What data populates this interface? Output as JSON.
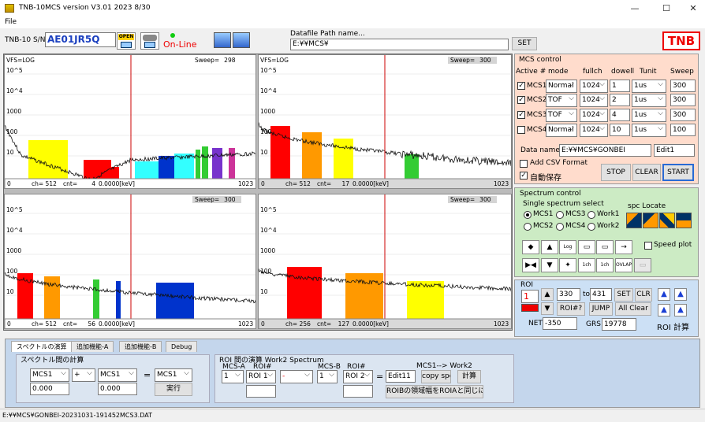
{
  "window": {
    "title": "TNB-10MCS  version V3.01  2023 8/30",
    "minimize": "—",
    "maximize": "☐",
    "close": "✕"
  },
  "menu": {
    "file": "File"
  },
  "header": {
    "sn_label": "TNB-10 S/N",
    "sn_value": "AE01JR5Q",
    "open_label": "OPEN",
    "online_label": "On-Line",
    "datafile_label": "Datafile Path name...",
    "datafile_value": "E:¥¥MCS¥",
    "set_label": "SET",
    "logo": "TNB"
  },
  "plots": [
    {
      "vfs": "VFS=LOG",
      "sweep_label": "Sweep=",
      "sweep": "298",
      "ch": "ch= 512",
      "cnt": "cnt=",
      "cnt_val": "4",
      "kev": "0.0000[keV]",
      "left": "0",
      "right": "1023",
      "y": [
        "10^5",
        "10^4",
        "1000",
        "100",
        "10"
      ]
    },
    {
      "vfs": "VFS=LOG",
      "sweep_label": "Sweep=",
      "sweep": "300",
      "ch": "ch= 512",
      "cnt": "cnt=",
      "cnt_val": "17",
      "kev": "0.0000[keV]",
      "left": "0",
      "right": "1023",
      "y": [
        "10^5",
        "10^4",
        "1000",
        "100",
        "10"
      ]
    },
    {
      "vfs": "",
      "sweep_label": "Sweep=",
      "sweep": "300",
      "ch": "ch= 512",
      "cnt": "cnt=",
      "cnt_val": "56",
      "kev": "0.0000[keV]",
      "left": "0",
      "right": "1023",
      "y": [
        "10^5",
        "10^4",
        "1000",
        "100",
        "10"
      ]
    },
    {
      "vfs": "",
      "sweep_label": "Sweep=",
      "sweep": "300",
      "ch": "ch= 256",
      "cnt": "cnt=",
      "cnt_val": "127",
      "kev": "0.0000[keV]",
      "left": "0",
      "right": "1023",
      "y": [
        "10^5",
        "10^4",
        "1000",
        "100",
        "10"
      ]
    }
  ],
  "mcs_control": {
    "title": "MCS control",
    "headers": [
      "Active #",
      "mode",
      "fullch",
      "dowell",
      "Tunit",
      "Sweep"
    ],
    "rows": [
      {
        "name": "MCS1",
        "checked": "✓",
        "mode": "Normal",
        "fullch": "1024",
        "dowell": "1",
        "tunit": "1us",
        "sweep": "300"
      },
      {
        "name": "MCS2",
        "checked": "✓",
        "mode": "TOF",
        "fullch": "1024",
        "dowell": "2",
        "tunit": "1us",
        "sweep": "300"
      },
      {
        "name": "MCS3",
        "checked": "✓",
        "mode": "TOF",
        "fullch": "1024",
        "dowell": "4",
        "tunit": "1us",
        "sweep": "300"
      },
      {
        "name": "MCS4",
        "checked": "",
        "mode": "Normal",
        "fullch": "1024",
        "dowell": "10",
        "tunit": "1us",
        "sweep": "100"
      }
    ],
    "dataname_label": "Data name",
    "dataname_value": "E:¥¥MCS¥GONBEI",
    "edit_value": "Edit1",
    "csv_label": "Add CSV Format",
    "autosave_label": "自動保存",
    "autosave_check": "✓",
    "stop": "STOP",
    "clear": "CLEAR",
    "start": "START"
  },
  "spectrum_control": {
    "title": "Spectrum control",
    "single_label": "Single spectrum select",
    "locate_label": "spc Locate",
    "radios": [
      "MCS1",
      "MCS3",
      "Work1",
      "MCS2",
      "MCS4",
      "Work2"
    ],
    "speed_plot": "Speed plot",
    "icons": [
      "◆",
      "▲",
      "Log",
      "▭",
      "▭",
      "→",
      "▶◀",
      "▼",
      "✦",
      "1ch",
      "1ch",
      "OVLAP"
    ]
  },
  "roi": {
    "title": "ROI",
    "index": "1",
    "from": "330",
    "to_label": "to",
    "to": "431",
    "set": "SET",
    "clr": "CLR",
    "roi_q": "ROI#?",
    "jump": "JUMP",
    "all_clear": "All Clear",
    "net_label": "NET",
    "net": "-350",
    "grs_label": "GRS",
    "grs": "19778",
    "calc": "ROI 計算"
  },
  "tabs": [
    "スペクトルの演算",
    "追加機能-A",
    "追加機能-B",
    "Debug"
  ],
  "calc": {
    "group_title": "スペクトル間の計算",
    "a": "MCS1",
    "op": "+",
    "b": "MCS1",
    "eq": "=",
    "c": "MCS1",
    "a_val": "0.000",
    "b_val": "0.000",
    "exec": "実行"
  },
  "roi_calc": {
    "group_title": "ROI 間の演算  Work2 Spectrum",
    "mcs_a_label": "MCS-A",
    "roi_a_label": "ROI#",
    "mcs_b_label": "MCS-B",
    "roi_b_label": "ROI#",
    "mcs_a": "1",
    "roi_a": "ROI 1",
    "op": "-",
    "mcs_b": "1",
    "roi_b": "ROI 2",
    "eq": "=",
    "edit": "Edit11",
    "work_label": "MCS1--> Work2",
    "copy": "copy spc",
    "calc": "計算",
    "same": "ROIBの領域幅をROIAと同じにする"
  },
  "status": {
    "path": "E:¥¥MCS¥GONBEI-20231031-191452MCS3.DAT"
  },
  "colors": {
    "red": "#ff0000",
    "orange": "#ff9900",
    "yellow": "#ffff00",
    "green": "#33cc33",
    "blue": "#0033cc",
    "cyan": "#33ffff",
    "purple": "#7733cc",
    "magenta": "#cc3399",
    "marker": "#cc0000"
  }
}
